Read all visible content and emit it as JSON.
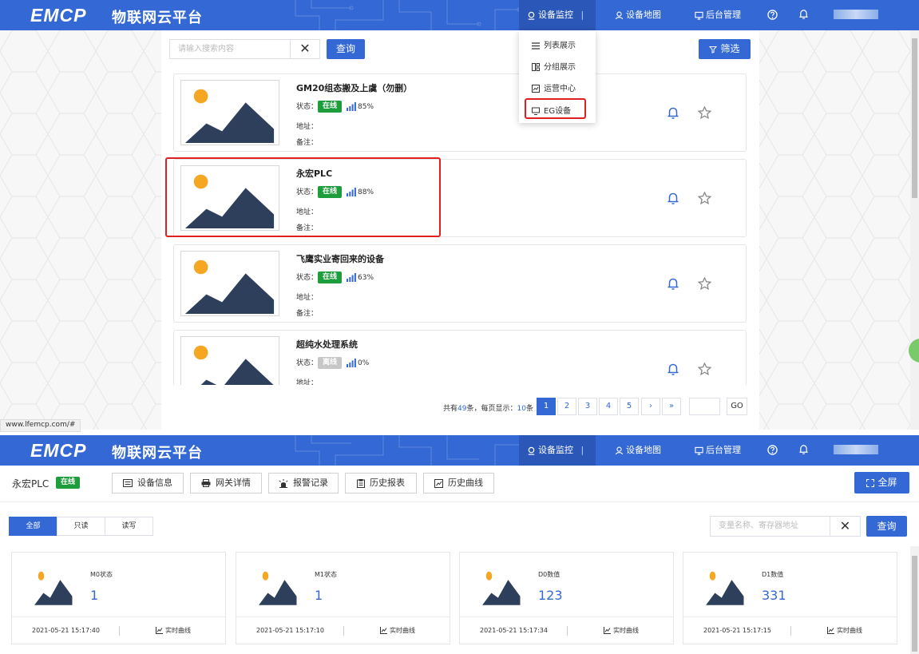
{
  "header": {
    "logo": "EMCP",
    "logo_cn": "物联网云平台",
    "nav_monitor": "设备监控",
    "nav_map": "设备地图",
    "nav_admin": "后台管理"
  },
  "top_panel": {
    "search_placeholder": "请输入搜索内容",
    "search_button": "查询",
    "filter_button": "筛选",
    "dropdown": [
      "列表展示",
      "分组展示",
      "运营中心",
      "EG设备"
    ],
    "labels": {
      "status": "状态：",
      "address": "地址：",
      "note": "备注："
    },
    "devices": [
      {
        "name": "GM20组态搬及上虞（勿删）",
        "status": "在线",
        "signal": "85%"
      },
      {
        "name": "永宏PLC",
        "status": "在线",
        "signal": "88%"
      },
      {
        "name": "飞鹰实业寄回来的设备",
        "status": "在线",
        "signal": "63%"
      },
      {
        "name": "超纯水处理系统",
        "status": "离线",
        "signal": "0%"
      }
    ],
    "pager": {
      "total_prefix": "共有",
      "total": "49",
      "total_mid": "条，每页显示：",
      "per_page": "10",
      "per_page_suffix": "条",
      "pages": [
        "1",
        "2",
        "3",
        "4",
        "5"
      ],
      "next": "›",
      "last": "»",
      "go": "GO"
    },
    "status_url": "www.lfemcp.com/#"
  },
  "bottom_panel": {
    "device_name": "永宏PLC",
    "status": "在线",
    "tabs": [
      "设备信息",
      "网关详情",
      "报警记录",
      "历史报表",
      "历史曲线"
    ],
    "fullscreen": "全屏",
    "filters": [
      "全部",
      "只读",
      "读写"
    ],
    "search_placeholder": "变量名称、寄存器地址",
    "search_button": "查询",
    "curve_label": "实时曲线",
    "variables": [
      {
        "name": "M0状态",
        "value": "1",
        "time": "2021-05-21 15:17:40"
      },
      {
        "name": "M1状态",
        "value": "1",
        "time": "2021-05-21 15:17:10"
      },
      {
        "name": "D0数值",
        "value": "123",
        "time": "2021-05-21 15:17:34"
      },
      {
        "name": "D1数值",
        "value": "331",
        "time": "2021-05-21 15:17:15"
      }
    ]
  },
  "colors": {
    "primary": "#3468d4",
    "online": "#1e9d3c",
    "offline": "#c7c7c7",
    "highlight": "#e02020"
  }
}
